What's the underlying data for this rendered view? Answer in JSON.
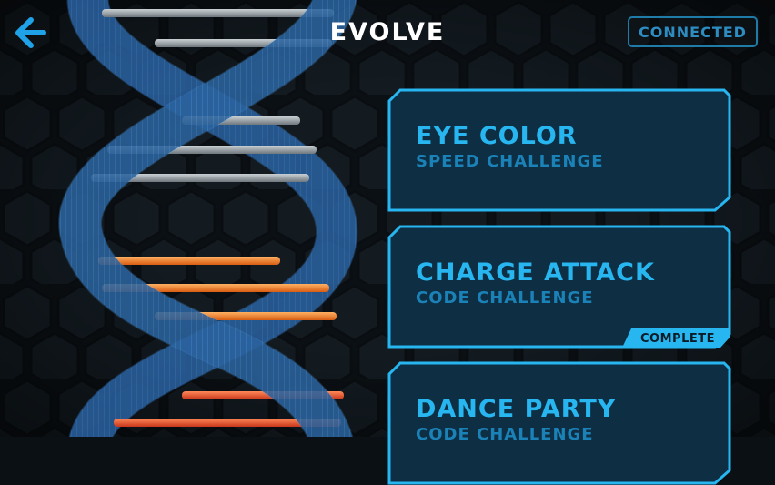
{
  "header": {
    "back_icon": "arrow-left-icon",
    "title": "EVOLVE",
    "status": "CONNECTED"
  },
  "challenges": [
    {
      "name": "EYE COLOR",
      "type": "SPEED CHALLENGE"
    },
    {
      "name": "CHARGE ATTACK",
      "type": "CODE CHALLENGE",
      "badge": "COMPLETE"
    },
    {
      "name": "DANCE PARTY",
      "type": "CODE CHALLENGE"
    }
  ],
  "colors": {
    "accent": "#27b6f0",
    "card_fill": "#0e2e44",
    "strand": "#2f7fd0",
    "rung_inactive": "#9aa4ab",
    "rung_active": "#f07a1e",
    "rung_active_2": "#e8502a"
  }
}
